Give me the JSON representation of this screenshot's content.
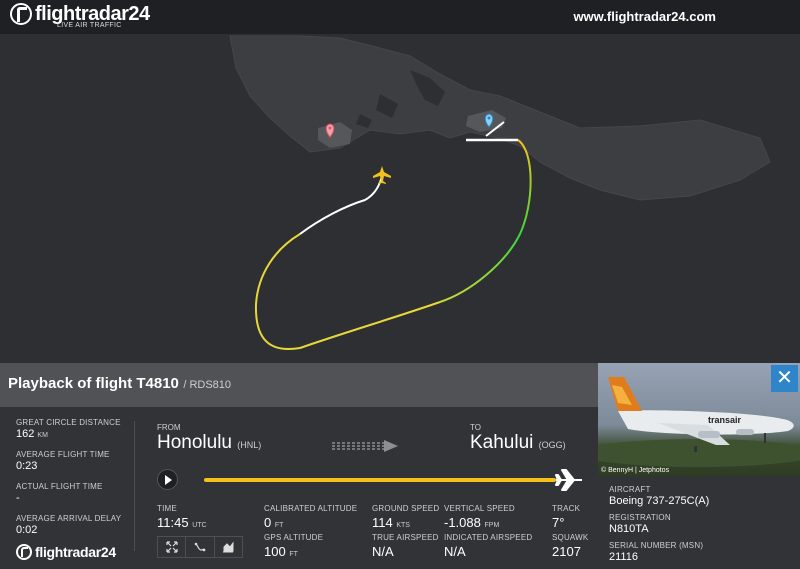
{
  "header": {
    "logo_text": "flightradar24",
    "logo_sub": "LIVE AIR TRAFFIC",
    "site_url": "www.flightradar24.com"
  },
  "flight": {
    "title": "Playback of flight T4810",
    "callsign": "/ RDS810"
  },
  "stats": {
    "great_circle_label": "GREAT CIRCLE DISTANCE",
    "great_circle_value": "162",
    "great_circle_unit": "KM",
    "avg_time_label": "AVERAGE FLIGHT TIME",
    "avg_time_value": "0:23",
    "actual_time_label": "ACTUAL FLIGHT TIME",
    "actual_time_value": "-",
    "avg_delay_label": "AVERAGE ARRIVAL DELAY",
    "avg_delay_value": "0:02"
  },
  "route": {
    "from_label": "FROM",
    "from_city": "Honolulu",
    "from_code": "(HNL)",
    "to_label": "TO",
    "to_city": "Kahului",
    "to_code": "(OGG)"
  },
  "metrics": {
    "time_label": "TIME",
    "time_value": "11:45",
    "time_unit": "UTC",
    "cal_alt_label": "CALIBRATED ALTITUDE",
    "cal_alt_value": "0",
    "cal_alt_unit": "FT",
    "gps_alt_label": "GPS ALTITUDE",
    "gps_alt_value": "100",
    "gps_alt_unit": "FT",
    "ground_speed_label": "GROUND SPEED",
    "ground_speed_value": "114",
    "ground_speed_unit": "KTS",
    "true_airspeed_label": "TRUE AIRSPEED",
    "true_airspeed_value": "N/A",
    "vertical_speed_label": "VERTICAL SPEED",
    "vertical_speed_value": "-1.088",
    "vertical_speed_unit": "FPM",
    "indicated_airspeed_label": "INDICATED AIRSPEED",
    "indicated_airspeed_value": "N/A",
    "track_label": "TRACK",
    "track_value": "7°",
    "squawk_label": "SQUAWK",
    "squawk_value": "2107"
  },
  "aircraft": {
    "photo_credit": "© BennyH | Jetphotos",
    "livery_text": "transair",
    "aircraft_label": "AIRCRAFT",
    "aircraft_value": "Boeing 737-275C(A)",
    "registration_label": "REGISTRATION",
    "registration_value": "N810TA",
    "serial_label": "SERIAL NUMBER (MSN)",
    "serial_value": "21116"
  },
  "footer": {
    "logo_text": "flightradar24"
  },
  "playback_progress": 1.0,
  "colors": {
    "accent_yellow": "#f1c21b",
    "close_blue": "#2e85c9",
    "panel_header": "#505255",
    "panel_bg": "#313336",
    "track_green": "#3cd63c",
    "track_white": "#ffffff"
  },
  "icons": [
    "logo-icon",
    "plane-icon",
    "pin-red-icon",
    "pin-blue-icon",
    "play-icon",
    "close-icon",
    "route-arrow-icon",
    "plane-track-icon",
    "expand-icon",
    "route-view-icon",
    "chart-icon"
  ]
}
